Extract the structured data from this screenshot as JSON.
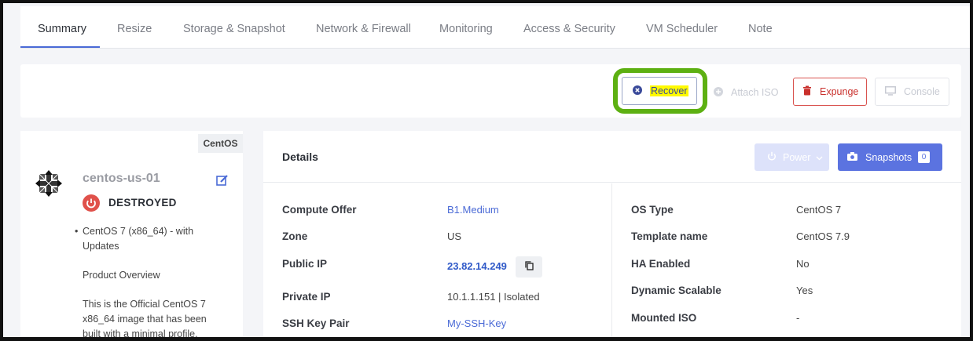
{
  "tabs": [
    "Summary",
    "Resize",
    "Storage & Snapshot",
    "Network & Firewall",
    "Monitoring",
    "Access & Security",
    "VM Scheduler",
    "Note"
  ],
  "actions": {
    "recover": "Recover",
    "attach_iso": "Attach ISO",
    "expunge": "Expunge",
    "console": "Console"
  },
  "vm": {
    "os_tag": "CentOS",
    "name": "centos-us-01",
    "status": "DESTROYED",
    "desc_bullet": "CentOS 7 (x86_64) - with Updates",
    "desc_heading": "Product Overview",
    "desc_body": "This is the Official CentOS 7 x86_64 image that has been built with a minimal profile,"
  },
  "details": {
    "title": "Details",
    "power_label": "Power",
    "snapshots_label": "Snapshots",
    "snapshots_count": "0",
    "left": [
      {
        "label": "Compute Offer",
        "value": "B1.Medium"
      },
      {
        "label": "Zone",
        "value": "US"
      },
      {
        "label": "Public IP",
        "value": "23.82.14.249"
      },
      {
        "label": "Private IP",
        "value": "10.1.1.151 | Isolated"
      },
      {
        "label": "SSH Key Pair",
        "value": "My-SSH-Key"
      }
    ],
    "right": [
      {
        "label": "OS Type",
        "value": "CentOS 7"
      },
      {
        "label": "Template name",
        "value": "CentOS 7.9"
      },
      {
        "label": "HA Enabled",
        "value": "No"
      },
      {
        "label": "Dynamic Scalable",
        "value": "Yes"
      },
      {
        "label": "Mounted ISO",
        "value": "-"
      }
    ]
  },
  "colors": {
    "accent": "#4a6ad6",
    "highlight_ring": "#5db012",
    "danger": "#d9534f"
  }
}
